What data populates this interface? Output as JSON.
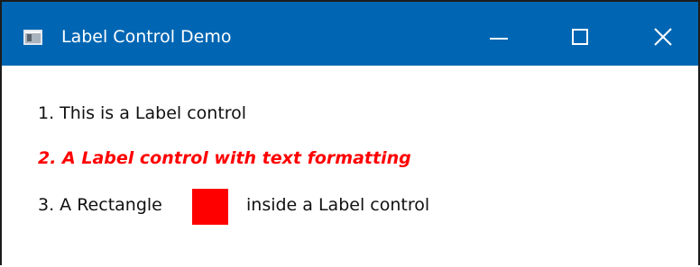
{
  "window": {
    "title": "Label Control Demo",
    "icon": "app-window-icon",
    "controls": {
      "minimize_icon": "minimize-icon",
      "maximize_icon": "maximize-icon",
      "close_icon": "close-icon"
    },
    "titlebar_color": "#0066b3"
  },
  "labels": {
    "label1": "1. This is a Label control",
    "label2": "2. A Label control with text formatting",
    "label3_before": "3. A Rectangle",
    "label3_after": "inside a Label control",
    "label2_color": "#ff0000",
    "rectangle_color": "#ff0000"
  }
}
